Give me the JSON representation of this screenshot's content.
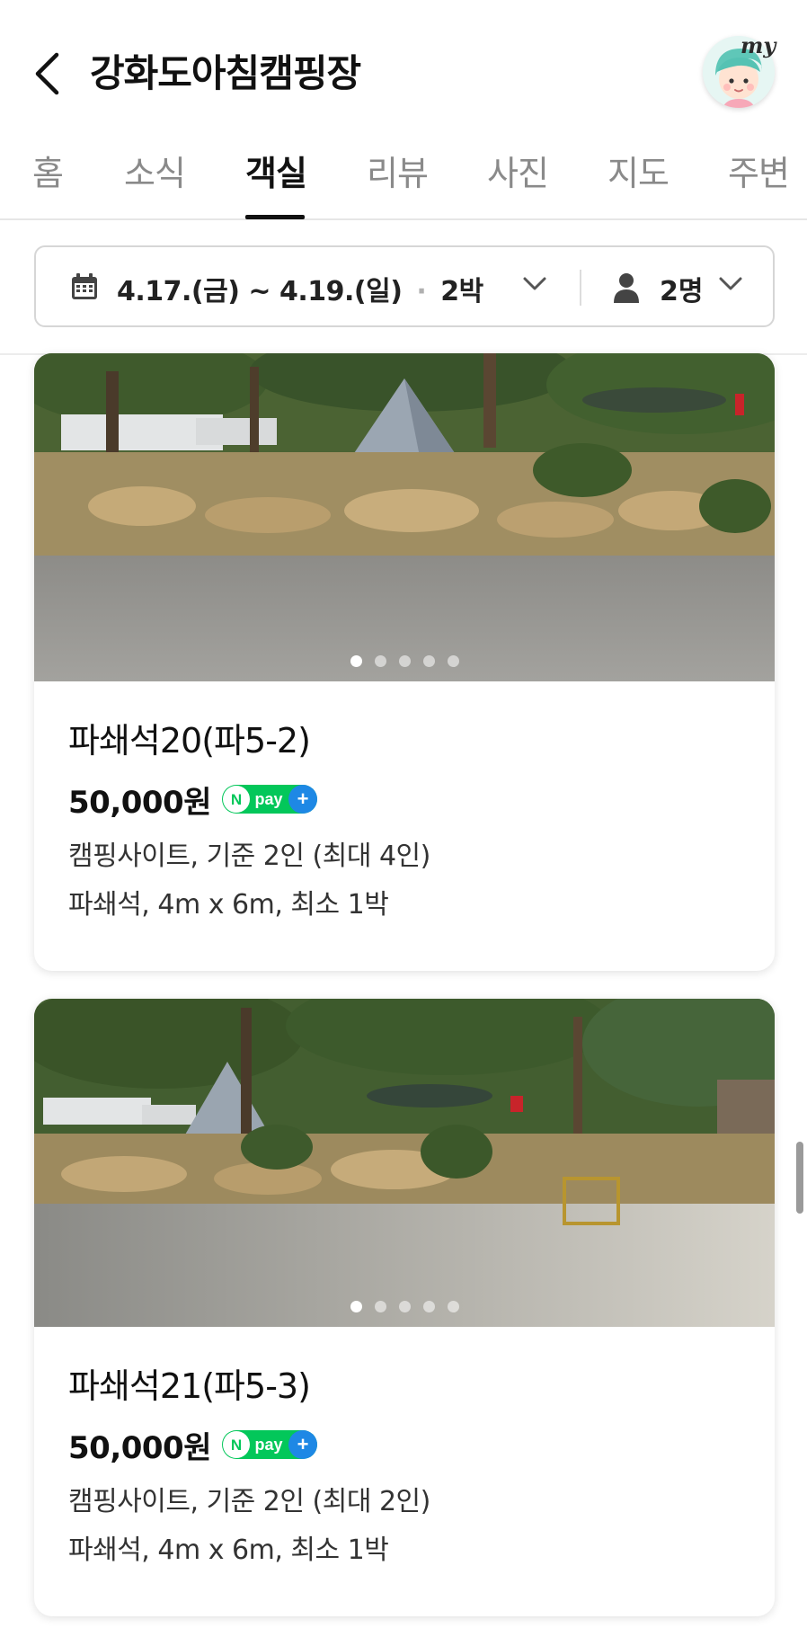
{
  "header": {
    "title": "강화도아침캠핑장",
    "avatar_badge": "my"
  },
  "tabs": [
    {
      "label": "홈"
    },
    {
      "label": "소식"
    },
    {
      "label": "객실"
    },
    {
      "label": "리뷰"
    },
    {
      "label": "사진"
    },
    {
      "label": "지도"
    },
    {
      "label": "주변"
    }
  ],
  "active_tab": "객실",
  "booking": {
    "date_range": "4.17.(금) ~ 4.19.(일)",
    "separator": "·",
    "nights": "2박",
    "guests": "2명"
  },
  "rooms": [
    {
      "name": "파쇄석20(파5-2)",
      "price": "50,000원",
      "payment_badge": "Npay+",
      "description_line1": "캠핑사이트, 기준 2인 (최대 4인)",
      "description_line2": "파쇄석, 4m x 6m, 최소 1박",
      "image_count": 5,
      "current_image": 1
    },
    {
      "name": "파쇄석21(파5-3)",
      "price": "50,000원",
      "payment_badge": "Npay+",
      "description_line1": "캠핑사이트, 기준 2인 (최대 2인)",
      "description_line2": "파쇄석, 4m x 6m, 최소 1박",
      "image_count": 5,
      "current_image": 1
    }
  ],
  "colors": {
    "npay_green": "#03c75a",
    "npay_blue": "#1e88e5",
    "text_primary": "#111111",
    "text_muted": "#8a8a8a"
  }
}
